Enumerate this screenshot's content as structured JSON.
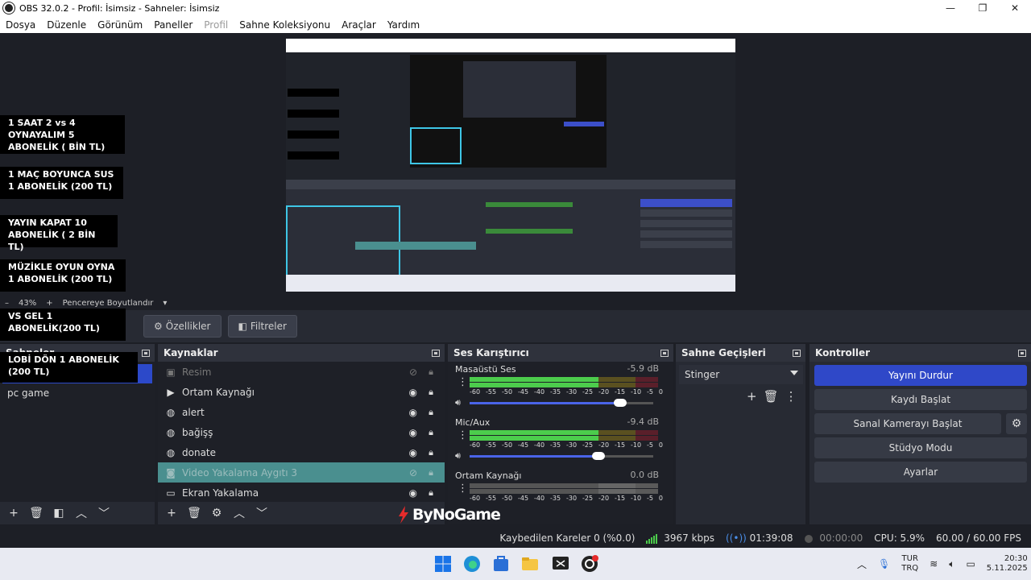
{
  "window": {
    "title": "OBS 32.0.2 - Profil: İsimsiz - Sahneler: İsimsiz",
    "min": "—",
    "max": "❐",
    "close": "✕"
  },
  "menu": [
    "Dosya",
    "Düzenle",
    "Görünüm",
    "Paneller",
    "Profil",
    "Sahne Koleksiyonu",
    "Araçlar",
    "Yardım"
  ],
  "overlay": {
    "label1": "1 SAAT 2 vs 4 OYNAYALIM 5 ABONELİK ( BİN TL)",
    "label2": "1 MAÇ BOYUNCA SUS 1 ABONELİK (200 TL)",
    "label3": "YAYIN KAPAT 10 ABONELİK ( 2 BİN TL)",
    "label4": "MÜZİKLE OYUN OYNA 1 ABONELİK (200 TL)",
    "label5": "VS GEL 1 ABONELİK(200 TL)",
    "label6": "LOBİ DÖN 1 ABONELİK (200 TL)"
  },
  "zoom": {
    "minus": "–",
    "value": "43%",
    "plus": "+",
    "mode": "Pencereye Boyutlandır"
  },
  "properties_bar": {
    "properties": "Özellikler",
    "filters": "Filtreler"
  },
  "scenes": {
    "title": "Sahneler",
    "items": [
      "pc game"
    ]
  },
  "sources": {
    "title": "Kaynaklar",
    "items": [
      {
        "name": "Resim",
        "icon": "image-icon",
        "state": "hidden"
      },
      {
        "name": "Ortam Kaynağı",
        "icon": "play-icon",
        "state": "visible"
      },
      {
        "name": "alert",
        "icon": "browser-icon",
        "state": "visible"
      },
      {
        "name": "bağişş",
        "icon": "browser-icon",
        "state": "visible"
      },
      {
        "name": "donate",
        "icon": "browser-icon",
        "state": "visible"
      },
      {
        "name": "Video Yakalama Aygıtı 3",
        "icon": "camera-icon",
        "state": "selected"
      },
      {
        "name": "Ekran Yakalama",
        "icon": "monitor-icon",
        "state": "visible"
      }
    ]
  },
  "mixer": {
    "title": "Ses Karıştırıcı",
    "ticks": [
      "-60",
      "-55",
      "-50",
      "-45",
      "-40",
      "-35",
      "-30",
      "-25",
      "-20",
      "-15",
      "-10",
      "-5",
      "0"
    ],
    "channels": [
      {
        "name": "Masaüstü Ses",
        "db": "-5.9 dB",
        "level": 0.86,
        "volume": 0.82
      },
      {
        "name": "Mic/Aux",
        "db": "-9.4 dB",
        "level": 0.82,
        "volume": 0.7
      },
      {
        "name": "Ortam Kaynağı",
        "db": "0.0 dB",
        "level": 0.0,
        "volume": 1.0
      }
    ]
  },
  "transitions": {
    "title": "Sahne Geçişleri",
    "selected": "Stinger"
  },
  "controls": {
    "title": "Kontroller",
    "stop_stream": "Yayını Durdur",
    "start_record": "Kaydı Başlat",
    "start_vcam": "Sanal Kamerayı Başlat",
    "studio_mode": "Stüdyo Modu",
    "settings": "Ayarlar"
  },
  "logo": {
    "text": "ByNoGame"
  },
  "status": {
    "dropped": "Kaybedilen Kareler 0 (%0.0)",
    "bitrate": "3967 kbps",
    "stream_time": "01:39:08",
    "record_time": "00:00:00",
    "cpu": "CPU: 5.9%",
    "fps": "60.00 / 60.00 FPS",
    "colors": {
      "live": "#4ccc4c",
      "accent": "#2f48c8"
    }
  },
  "taskbar": {
    "lang_top": "TUR",
    "lang_bottom": "TRQ",
    "time": "20:30",
    "date": "5.11.2025"
  }
}
